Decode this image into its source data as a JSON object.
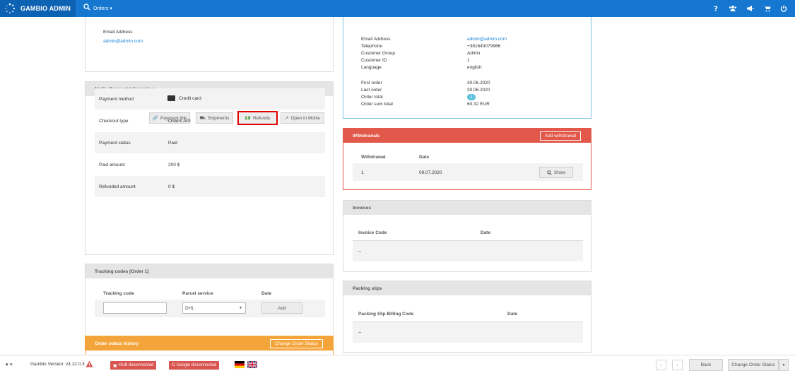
{
  "app": {
    "title": "GAMBIO ADMIN",
    "menu_label": "Orders ▾"
  },
  "topbar_icons": [
    "help-icon",
    "users-icon",
    "megaphone-icon",
    "cart-icon",
    "power-icon"
  ],
  "customer": {
    "email_label": "Email Address",
    "email": "admin@admin.com"
  },
  "customer_info": {
    "rows": [
      {
        "label": "Email Address",
        "value": "admin@admin.com",
        "link": true
      },
      {
        "label": "Telephone",
        "value": "+381643079966"
      },
      {
        "label": "Customer Group",
        "value": "Admin"
      },
      {
        "label": "Customer ID",
        "value": "1"
      },
      {
        "label": "Language",
        "value": "english"
      }
    ],
    "stats": [
      {
        "label": "First order",
        "value": "30.06.2020"
      },
      {
        "label": "Last order",
        "value": "30.06.2020"
      },
      {
        "label": "Order total",
        "value": "1",
        "badge": true
      },
      {
        "label": "Order sum total",
        "value": "60.32 EUR"
      }
    ]
  },
  "mollie": {
    "title": "Mollie Payment Information",
    "buttons": {
      "payment_link": "Payment link",
      "shipments": "Shipments",
      "refunds": "Refunds",
      "open": "Open in Mollie"
    },
    "rows": [
      {
        "label": "Payment method",
        "value": "Credit card"
      },
      {
        "label": "Checkout type",
        "value": "Orders API"
      },
      {
        "label": "Payment status",
        "value": "Paid"
      },
      {
        "label": "Paid amount",
        "value": "200 $"
      },
      {
        "label": "Refunded amount",
        "value": "0 $"
      }
    ]
  },
  "tracking": {
    "title": "Tracking codes [Order 1]",
    "col_code": "Tracking code",
    "col_service": "Parcel service",
    "col_date": "Date",
    "service_value": "DHL",
    "add_label": "Add"
  },
  "status_history": {
    "title": "Order status history",
    "button": "Change Order Status"
  },
  "withdrawals": {
    "title": "Withdrawals",
    "add_button": "Add withdrawal",
    "col_withdrawal": "Withdrawal",
    "col_date": "Date",
    "row": {
      "id": "1",
      "date": "09.07.2020",
      "show": "Show"
    }
  },
  "invoices": {
    "title": "Invoices",
    "col_code": "Invoice Code",
    "col_date": "Date",
    "empty": "--"
  },
  "packing": {
    "title": "Packing slips",
    "col_code": "Packing Slip Billing Code",
    "col_date": "Date",
    "empty": "--"
  },
  "footer": {
    "menu_toggle": "▾ ≡",
    "version": "Gambio Version: v3.12.0.3",
    "hub": "HUB disconnected",
    "google": "Google disconnected",
    "back": "Back",
    "change_status": "Change Order Status"
  },
  "colors": {
    "brand": "#1577d0",
    "withdraw": "#e2584a",
    "status": "#f3a43a",
    "link": "#1a84d8",
    "highlight": "#e00000"
  }
}
